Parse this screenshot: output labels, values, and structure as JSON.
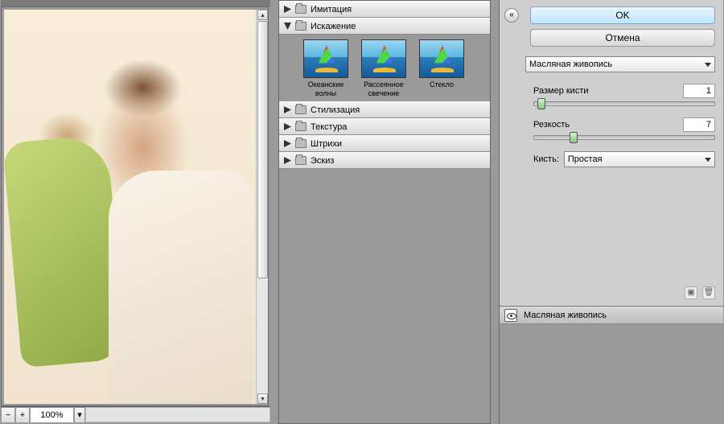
{
  "zoom": {
    "level": "100%"
  },
  "categories": [
    {
      "label": "Имитация",
      "expanded": false
    },
    {
      "label": "Искажение",
      "expanded": true,
      "items": [
        {
          "label": "Океанские волны"
        },
        {
          "label": "Рассеянное свечение"
        },
        {
          "label": "Стекло"
        }
      ]
    },
    {
      "label": "Стилизация",
      "expanded": false
    },
    {
      "label": "Текстура",
      "expanded": false
    },
    {
      "label": "Штрихи",
      "expanded": false
    },
    {
      "label": "Эскиз",
      "expanded": false
    }
  ],
  "buttons": {
    "ok": "OK",
    "cancel": "Отмена"
  },
  "filter_select": "Масляная живопись",
  "params": {
    "brush_size": {
      "label": "Размер кисти",
      "value": "1",
      "pos_pct": 4
    },
    "sharpness": {
      "label": "Резкость",
      "value": "7",
      "pos_pct": 22
    }
  },
  "brush": {
    "label": "Кисть:",
    "value": "Простая"
  },
  "layers": [
    {
      "name": "Масляная живопись"
    }
  ],
  "icons": {
    "collapse": "«",
    "new_layer": "▣",
    "trash": "🗑"
  }
}
